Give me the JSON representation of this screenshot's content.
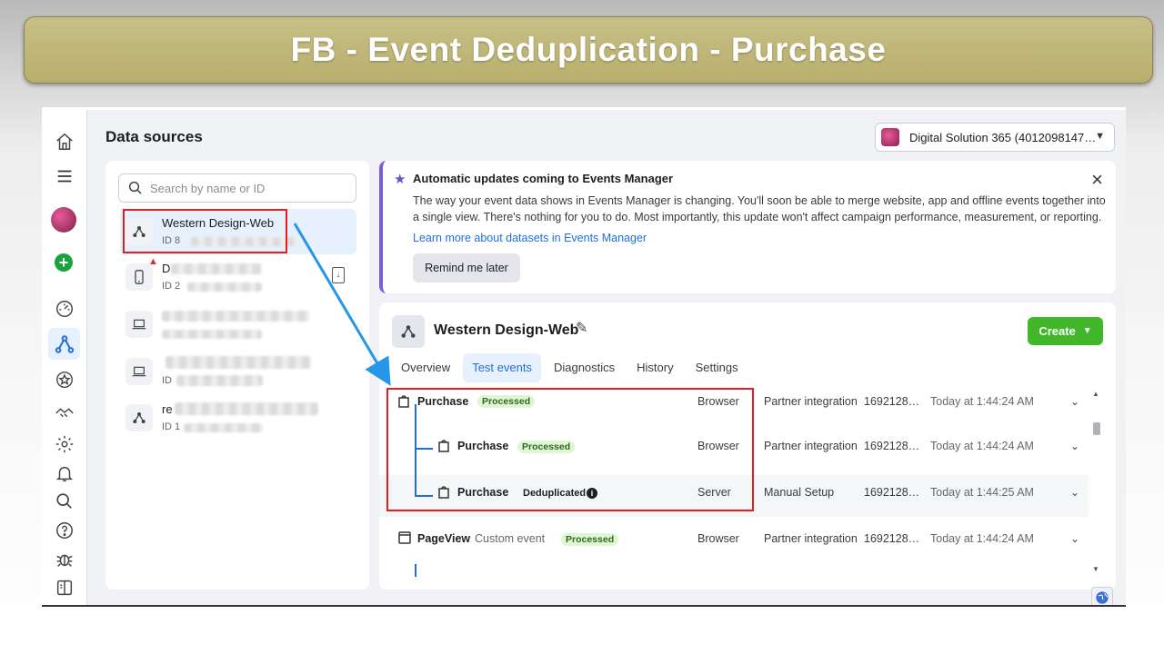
{
  "banner": {
    "title": "FB - Event Deduplication - Purchase"
  },
  "header": {
    "page_title": "Data sources",
    "account_label": "Digital Solution 365 (4012098147…"
  },
  "search": {
    "placeholder": "Search by name or ID"
  },
  "sources": [
    {
      "name": "Western Design-Web",
      "id_prefix": "ID 8",
      "selected": true
    },
    {
      "name": "D",
      "id_prefix": "ID 2",
      "warning": true
    },
    {
      "name": "",
      "id_prefix": ""
    },
    {
      "name": "",
      "id_prefix": "ID"
    },
    {
      "name": "re",
      "id_prefix": "ID 1"
    }
  ],
  "notice": {
    "title": "Automatic updates coming to Events Manager",
    "body": "The way your event data shows in Events Manager is changing. You'll soon be able to merge website, app and offline events together into a single view. There's nothing for you to do. Most importantly, this update won't affect campaign performance, measurement, or reporting.",
    "link": "Learn more about datasets in Events Manager",
    "button": "Remind me later"
  },
  "detail": {
    "name": "Western Design-Web",
    "create_label": "Create",
    "tabs": [
      "Overview",
      "Test events",
      "Diagnostics",
      "History",
      "Settings"
    ],
    "active_tab": "Test events"
  },
  "events": [
    {
      "name": "Purchase",
      "badge": "Processed",
      "source": "Browser",
      "setup": "Partner integration",
      "event_id": "1692128…",
      "time": "Today at 1:44:24 AM"
    },
    {
      "name": "Purchase",
      "badge": "Processed",
      "source": "Browser",
      "setup": "Partner integration",
      "event_id": "1692128…",
      "time": "Today at 1:44:24 AM"
    },
    {
      "name": "Purchase",
      "badge": "Deduplicated",
      "source": "Server",
      "setup": "Manual Setup",
      "event_id": "1692128…",
      "time": "Today at 1:44:25 AM"
    },
    {
      "name": "PageView",
      "custom": "Custom event",
      "badge": "Processed",
      "source": "Browser",
      "setup": "Partner integration",
      "event_id": "1692128…",
      "time": "Today at 1:44:24 AM"
    }
  ],
  "colors": {
    "banner": "#bfb676",
    "accent": "#216fdb",
    "create": "#42b72a",
    "highlight": "#e02020",
    "notice_border": "#7f5bd5"
  }
}
